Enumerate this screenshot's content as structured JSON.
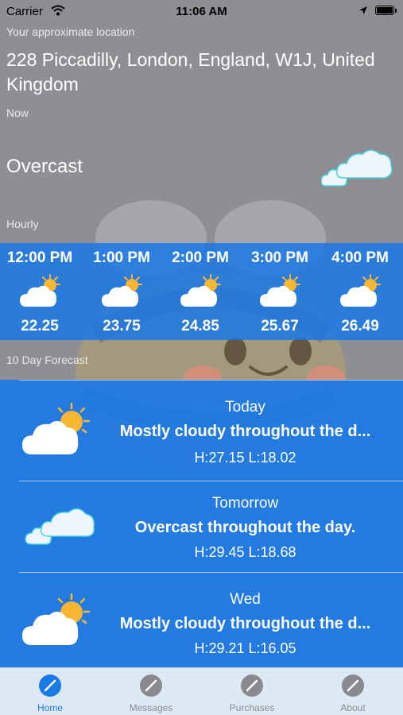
{
  "status_bar": {
    "carrier": "Carrier",
    "time": "11:06 AM"
  },
  "location": {
    "label": "Your approximate location",
    "address": "228 Piccadilly, London, England, W1J, United Kingdom"
  },
  "now": {
    "label": "Now",
    "condition": "Overcast",
    "icon": "cloud-icon"
  },
  "hourly": {
    "label": "Hourly",
    "items": [
      {
        "time": "12:00 PM",
        "temp": "22.25",
        "icon": "partly-cloudy-icon"
      },
      {
        "time": "1:00 PM",
        "temp": "23.75",
        "icon": "partly-cloudy-icon"
      },
      {
        "time": "2:00 PM",
        "temp": "24.85",
        "icon": "partly-cloudy-icon"
      },
      {
        "time": "3:00 PM",
        "temp": "25.67",
        "icon": "partly-cloudy-icon"
      },
      {
        "time": "4:00 PM",
        "temp": "26.49",
        "icon": "partly-cloudy-icon"
      }
    ]
  },
  "forecast": {
    "label": "10 Day Forecast",
    "days": [
      {
        "day": "Today",
        "description": "Mostly cloudy throughout the d...",
        "hl": "H:27.15 L:18.02",
        "icon": "partly-cloudy-icon"
      },
      {
        "day": "Tomorrow",
        "description": "Overcast throughout the day.",
        "hl": "H:29.45 L:18.68",
        "icon": "cloud-icon"
      },
      {
        "day": "Wed",
        "description": "Mostly cloudy throughout the d...",
        "hl": "H:29.21 L:16.05",
        "icon": "partly-cloudy-icon"
      }
    ]
  },
  "tabs": [
    {
      "label": "Home",
      "active": true,
      "icon": "pencil-icon"
    },
    {
      "label": "Messages",
      "active": false,
      "icon": "pencil-icon"
    },
    {
      "label": "Purchases",
      "active": false,
      "icon": "pencil-icon"
    },
    {
      "label": "About",
      "active": false,
      "icon": "pencil-icon"
    }
  ],
  "colors": {
    "accent": "#1a7be6",
    "background": "#8e8e93",
    "tab_bar": "#dde9f5"
  }
}
